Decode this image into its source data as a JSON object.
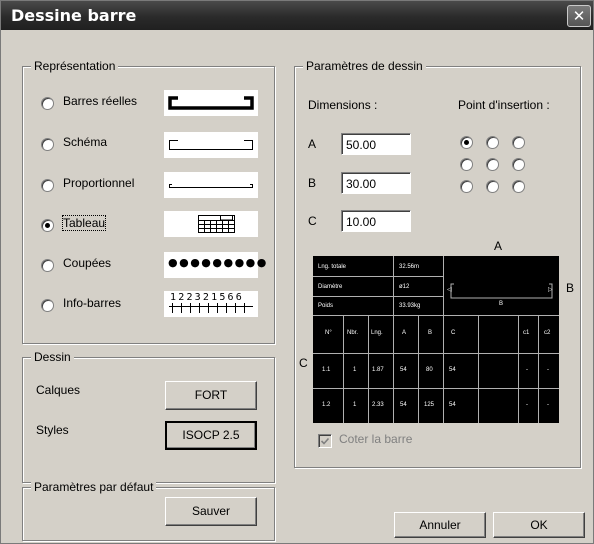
{
  "window": {
    "title": "Dessine barre"
  },
  "representation": {
    "legend": "Représentation",
    "options": [
      {
        "label": "Barres réelles",
        "checked": false
      },
      {
        "label": "Schéma",
        "checked": false
      },
      {
        "label": "Proportionnel",
        "checked": false
      },
      {
        "label": "Tableau",
        "checked": true
      },
      {
        "label": "Coupées",
        "checked": false
      },
      {
        "label": "Info-barres",
        "checked": false
      }
    ],
    "dots": "●●●●●●●●●",
    "info_digits": "122321566"
  },
  "dessin": {
    "legend": "Dessin",
    "calques_label": "Calques",
    "calques_value": "FORT",
    "styles_label": "Styles",
    "styles_value": "ISOCP 2.5"
  },
  "defaults": {
    "legend": "Paramètres par défaut",
    "save_label": "Sauver"
  },
  "params": {
    "legend": "Paramètres de dessin",
    "dimensions_label": "Dimensions :",
    "insertion_label": "Point d'insertion :",
    "dims": [
      {
        "letter": "A",
        "value": "50.00"
      },
      {
        "letter": "B",
        "value": "30.00"
      },
      {
        "letter": "C",
        "value": "10.00"
      }
    ],
    "insertion_selected": "top-left",
    "preview_labels": {
      "a": "A",
      "b": "B",
      "c": "C",
      "inner_b": "B",
      "inner_left": "◁",
      "inner_right": "▷"
    },
    "info_rows": [
      {
        "label": "Lng. totale",
        "value": "32.56m"
      },
      {
        "label": "Diamètre",
        "value": "ø12"
      },
      {
        "label": "Poids",
        "value": "33.93kg"
      }
    ],
    "table_headers": [
      "N°",
      "Nbr.",
      "Lng.",
      "A",
      "B",
      "C",
      "",
      "c1",
      "c2"
    ],
    "table_rows": [
      [
        "1.1",
        "1",
        "1.87",
        "54",
        "80",
        "54",
        "",
        "-",
        "-"
      ],
      [
        "1.2",
        "1",
        "2.33",
        "54",
        "125",
        "54",
        "",
        "-",
        "-"
      ]
    ],
    "coter_label": "Coter la barre",
    "coter_checked": true
  },
  "buttons": {
    "cancel": "Annuler",
    "ok": "OK"
  }
}
